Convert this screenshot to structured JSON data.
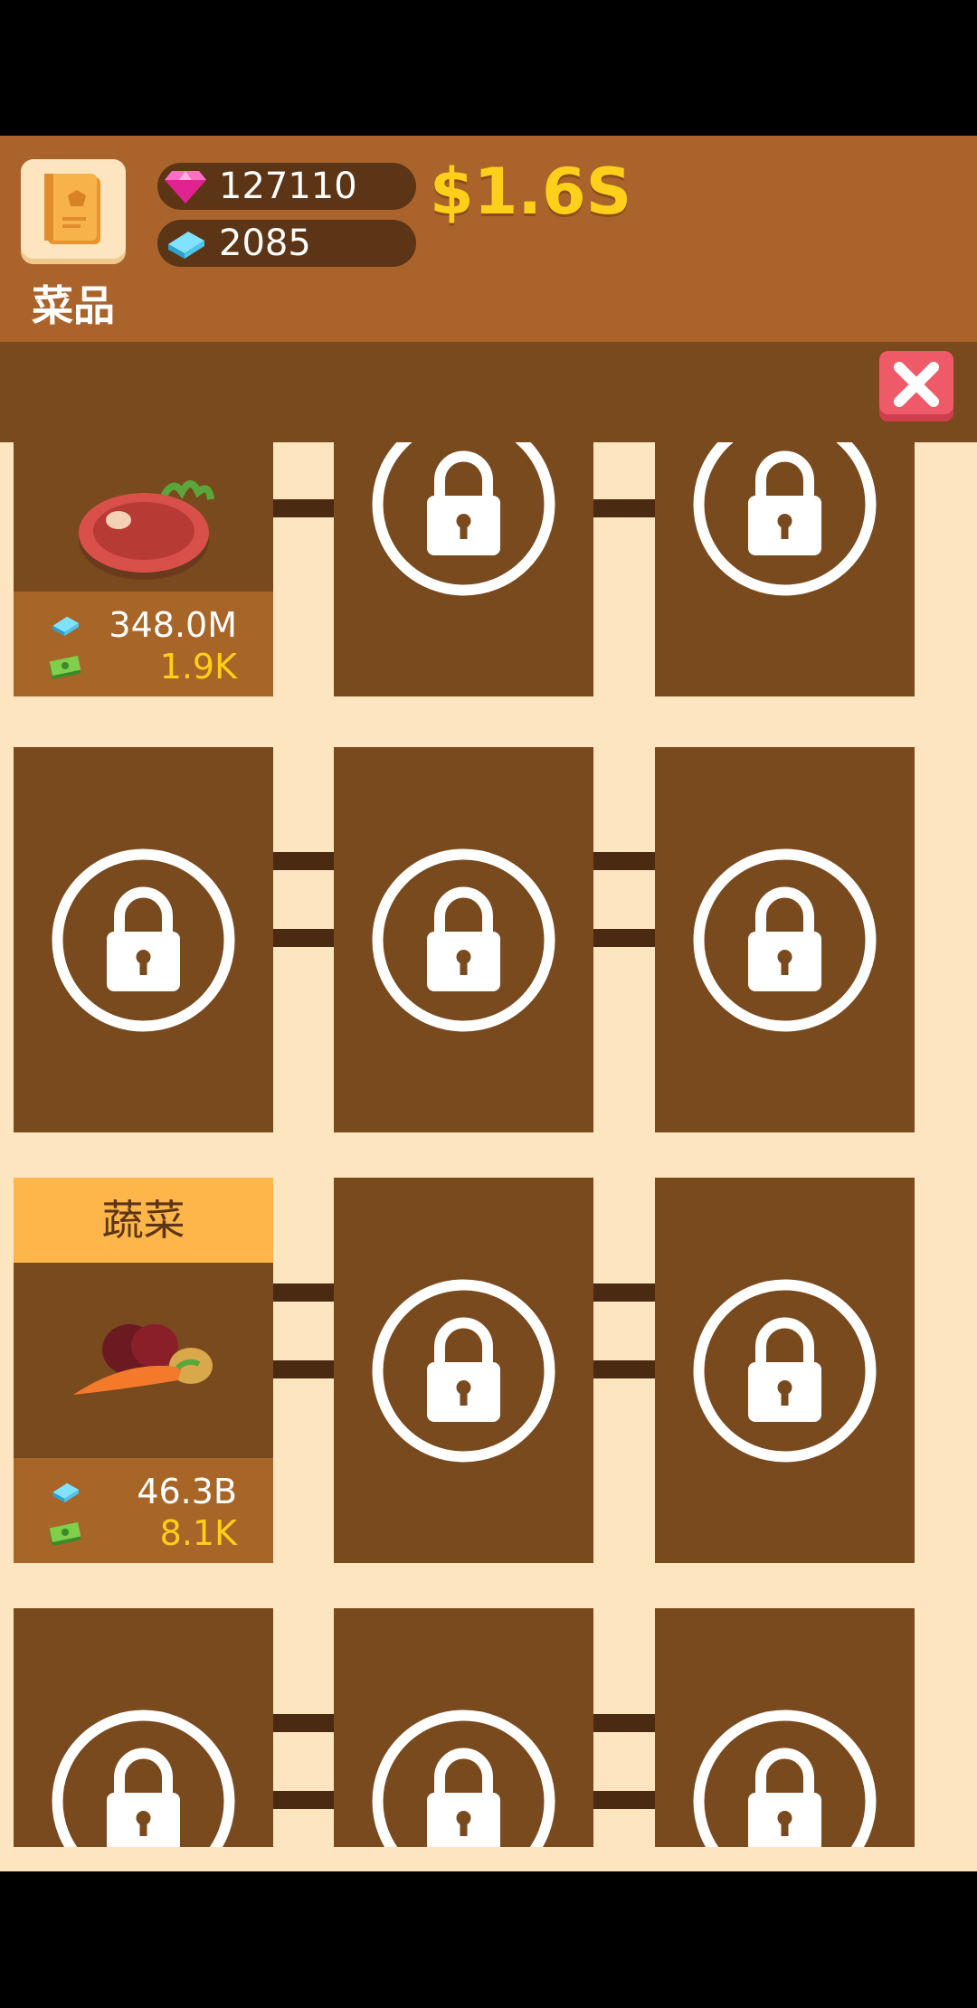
{
  "header": {
    "category_label": "菜品",
    "gem_count": "127110",
    "book_count": "2085",
    "money": "$1.6S"
  },
  "cards": [
    {
      "id": "steak",
      "state": "unlocked",
      "header": "",
      "stats": {
        "cost": "348.0M",
        "income": "1.9K"
      }
    },
    {
      "id": "r1c2",
      "state": "locked"
    },
    {
      "id": "r1c3",
      "state": "locked"
    },
    {
      "id": "r2c1",
      "state": "locked"
    },
    {
      "id": "r2c2",
      "state": "locked"
    },
    {
      "id": "r2c3",
      "state": "locked"
    },
    {
      "id": "vegetables",
      "state": "unlocked",
      "header": "蔬菜",
      "stats": {
        "cost": "46.3B",
        "income": "8.1K"
      }
    },
    {
      "id": "r3c2",
      "state": "locked"
    },
    {
      "id": "r3c3",
      "state": "locked"
    },
    {
      "id": "r4c1",
      "state": "locked"
    },
    {
      "id": "r4c2",
      "state": "locked"
    },
    {
      "id": "r4c3",
      "state": "locked"
    }
  ],
  "colors": {
    "header_bg": "#ab632c",
    "card_bg": "#7a4a1f",
    "grid_bg": "#fce5bf",
    "money": "#ffcf1a",
    "close": "#ee5a68",
    "label_bg": "#feb54a"
  }
}
